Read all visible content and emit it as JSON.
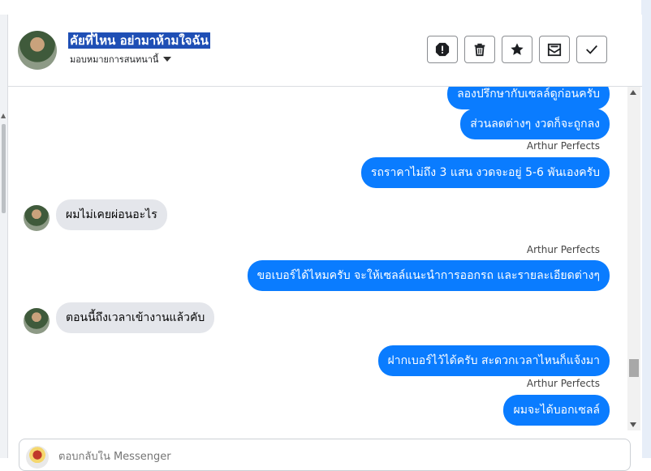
{
  "header": {
    "title": "คัยที่ไหน อย่ามาห้ามใจฉัน",
    "subtitle": "มอบหมายการสนทนานี้"
  },
  "actions": [
    {
      "name": "report-icon"
    },
    {
      "name": "trash-icon"
    },
    {
      "name": "star-icon"
    },
    {
      "name": "mark-unread-icon"
    },
    {
      "name": "check-icon"
    }
  ],
  "messages": {
    "m1": "ลองปรึกษากับเซลล์ดูก่อนครับ",
    "m2": "ส่วนลดต่างๆ งวดก็จะถูกลง",
    "s1": "Arthur Perfects",
    "m3": "รถราคาไม่ถึง 3 แสน งวดจะอยู่ 5-6 พันเองครับ",
    "in1": "ผมไม่เคยผ่อนอะไร",
    "s2": "Arthur Perfects",
    "m4": "ขอเบอร์ได้ไหมครับ จะให้เซลล์แนะนำการออกรถ และรายละเอียดต่างๆ",
    "in2": "ตอนนี้ถึงเวลาเข้างานแล้วคับ",
    "m5": "ฝากเบอร์ไว้ได้ครับ สะดวกเวลาไหนก็แจ้งมา",
    "s3": "Arthur Perfects",
    "m6": "ผมจะได้บอกเซลล์"
  },
  "composer": {
    "placeholder": "ตอบกลับใน Messenger"
  },
  "colors": {
    "outgoing_bubble": "#0a7cff",
    "incoming_bubble": "#e4e6eb",
    "title_highlight": "#1f4fb5"
  }
}
